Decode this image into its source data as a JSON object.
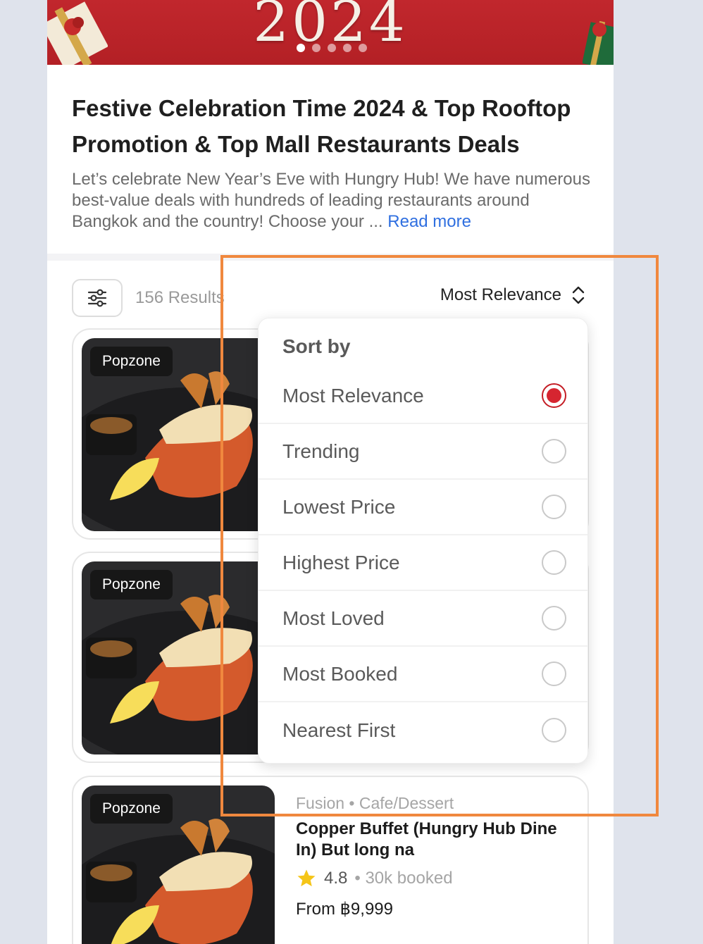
{
  "banner": {
    "year": "2024",
    "carousel_dots": 5,
    "active_dot": 0
  },
  "header": {
    "title": "Festive Celebration Time 2024 & Top Rooftop Promotion & Top Mall Restaurants Deals",
    "description": "Let’s celebrate New Year’s Eve with Hungry Hub! We have numerous best-value deals with hundreds of leading restaurants around Bangkok and the country! Choose your ... ",
    "read_more": "Read more"
  },
  "toolbar": {
    "filter_icon": "sliders-icon",
    "results_count": "156 Results",
    "sort_selected": "Most Relevance",
    "sort_icon": "chevron-up-down-icon"
  },
  "sort_menu": {
    "title": "Sort by",
    "options": [
      {
        "label": "Most Relevance",
        "selected": true
      },
      {
        "label": "Trending",
        "selected": false
      },
      {
        "label": "Lowest Price",
        "selected": false
      },
      {
        "label": "Highest Price",
        "selected": false
      },
      {
        "label": "Most Loved",
        "selected": false
      },
      {
        "label": "Most Booked",
        "selected": false
      },
      {
        "label": "Nearest First",
        "selected": false
      }
    ]
  },
  "cards": [
    {
      "badge": "Popzone"
    },
    {
      "badge": "Popzone"
    },
    {
      "badge": "Popzone",
      "cuisine": "Fusion • Cafe/Dessert",
      "name": "Copper Buffet (Hungry Hub Dine In) But long na",
      "rating": "4.8",
      "booked": "• 30k booked",
      "price": "From ฿9,999"
    }
  ],
  "colors": {
    "brand_red": "#c41d25",
    "link_blue": "#2f6fe0",
    "highlight_orange": "#f0883e"
  }
}
